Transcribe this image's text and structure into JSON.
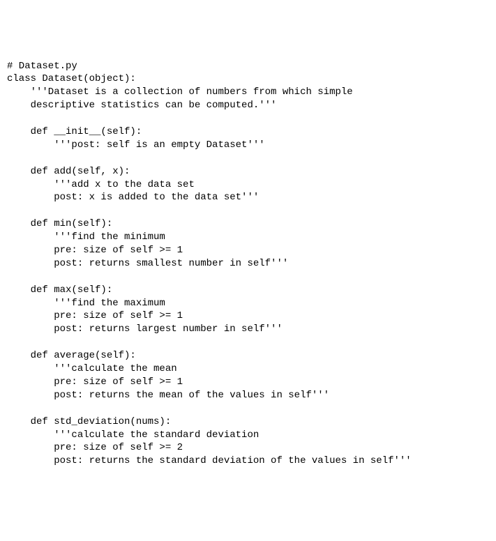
{
  "code": {
    "l01": "# Dataset.py",
    "l02": "class Dataset(object):",
    "l03": "    '''Dataset is a collection of numbers from which simple",
    "l04": "    descriptive statistics can be computed.'''",
    "l05": "",
    "l06": "    def __init__(self):",
    "l07": "        '''post: self is an empty Dataset'''",
    "l08": "",
    "l09": "    def add(self, x):",
    "l10": "        '''add x to the data set",
    "l11": "        post: x is added to the data set'''",
    "l12": "",
    "l13": "    def min(self):",
    "l14": "        '''find the minimum",
    "l15": "        pre: size of self >= 1",
    "l16": "        post: returns smallest number in self'''",
    "l17": "",
    "l18": "    def max(self):",
    "l19": "        '''find the maximum",
    "l20": "        pre: size of self >= 1",
    "l21": "        post: returns largest number in self'''",
    "l22": "",
    "l23": "    def average(self):",
    "l24": "        '''calculate the mean",
    "l25": "        pre: size of self >= 1",
    "l26": "        post: returns the mean of the values in self'''",
    "l27": "",
    "l28": "    def std_deviation(nums):",
    "l29": "        '''calculate the standard deviation",
    "l30": "        pre: size of self >= 2",
    "l31": "        post: returns the standard deviation of the values in self'''"
  }
}
